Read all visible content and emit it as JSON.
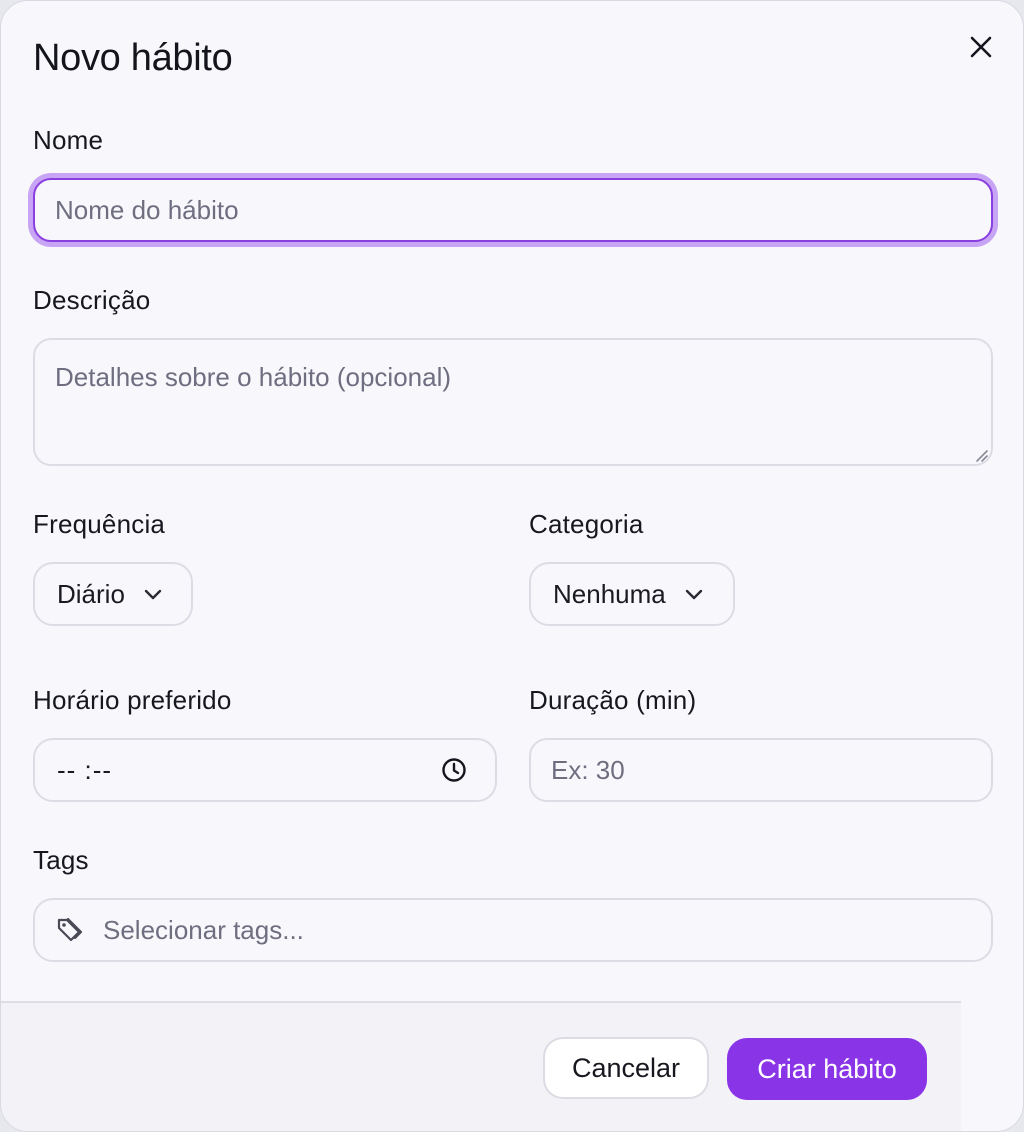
{
  "dialog": {
    "title": "Novo hábito",
    "close_icon": "close-icon"
  },
  "form": {
    "name": {
      "label": "Nome",
      "placeholder": "Nome do hábito",
      "value": ""
    },
    "description": {
      "label": "Descrição",
      "placeholder": "Detalhes sobre o hábito (opcional)",
      "value": ""
    },
    "frequency": {
      "label": "Frequência",
      "selected": "Diário",
      "icon": "chevron-down-icon"
    },
    "category": {
      "label": "Categoria",
      "selected": "Nenhuma",
      "icon": "chevron-down-icon"
    },
    "preferred_time": {
      "label": "Horário preferido",
      "value": "-- :--",
      "icon": "clock-icon"
    },
    "duration": {
      "label": "Duração (min)",
      "placeholder": "Ex: 30",
      "value": ""
    },
    "tags": {
      "label": "Tags",
      "placeholder": "Selecionar tags...",
      "icon": "tag-icon"
    }
  },
  "footer": {
    "cancel_label": "Cancelar",
    "submit_label": "Criar hábito"
  },
  "colors": {
    "accent": "#8a34e8",
    "focus_ring": "#c8a4f4",
    "border": "#dcdce4",
    "background": "#f8f8fc",
    "footer_background": "#f2f2f7"
  }
}
